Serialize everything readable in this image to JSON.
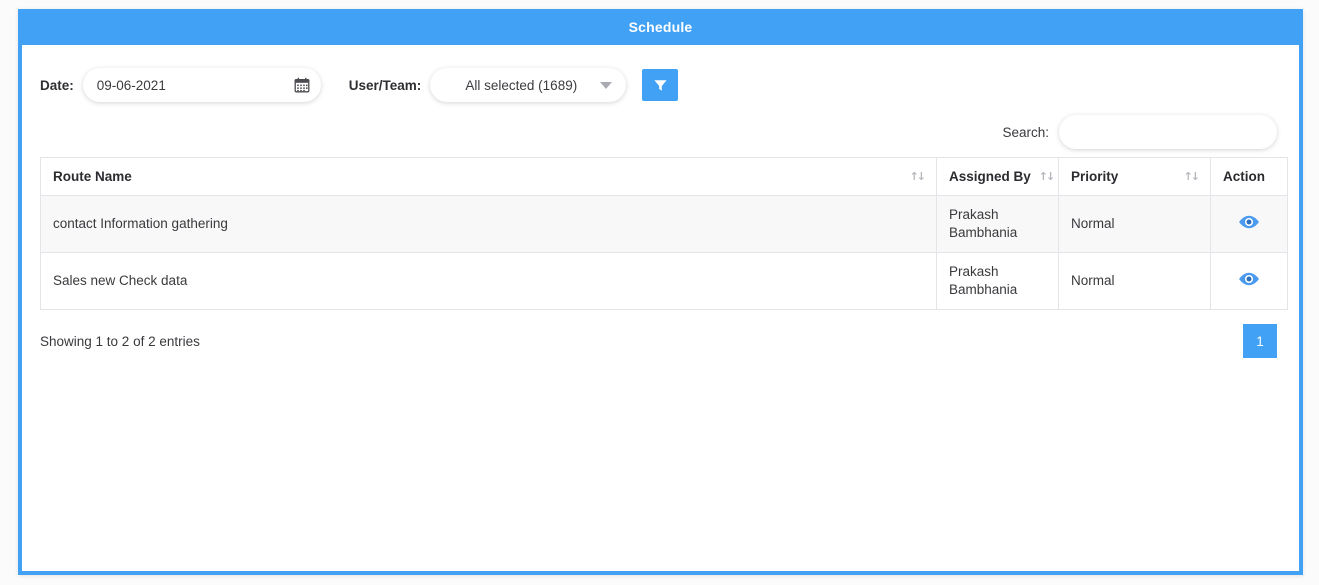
{
  "window": {
    "title": "Schedule",
    "accent_color": "#41a1f5",
    "header_text_color": "#ffffff"
  },
  "toolbar": {
    "date_label": "Date:",
    "date_value": "09-06-2021",
    "date_placeholder": "dd-mm-yyyy",
    "calendar_icon": "calendar-icon",
    "team_label": "User/Team:",
    "team_value": "All selected (1689)",
    "team_caret_icon": "chevron-down-icon",
    "filter_button_icon": "filter-icon",
    "filter_button_label": ""
  },
  "search": {
    "label": "Search:",
    "value": "",
    "placeholder": ""
  },
  "table": {
    "columns": [
      {
        "label": "Route Name",
        "sortable": true,
        "sort_icon": "sort-updown-icon"
      },
      {
        "label": "Assigned By",
        "sortable": true,
        "sort_icon": "sort-updown-icon"
      },
      {
        "label": "Priority",
        "sortable": true,
        "sort_icon": "sort-updown-icon"
      },
      {
        "label": "Action",
        "sortable": false,
        "sort_icon": ""
      }
    ],
    "rows": [
      {
        "route_name": "contact Information gathering",
        "assigned_by": "Prakash Bambhania",
        "priority": "Normal",
        "action_icon": "eye-icon"
      },
      {
        "route_name": "Sales new Check data",
        "assigned_by": "Prakash Bambhania",
        "priority": "Normal",
        "action_icon": "eye-icon"
      }
    ]
  },
  "footer": {
    "info": "Showing 1 to 2 of 2 entries",
    "pages": [
      {
        "label": "1",
        "active": true
      }
    ]
  }
}
